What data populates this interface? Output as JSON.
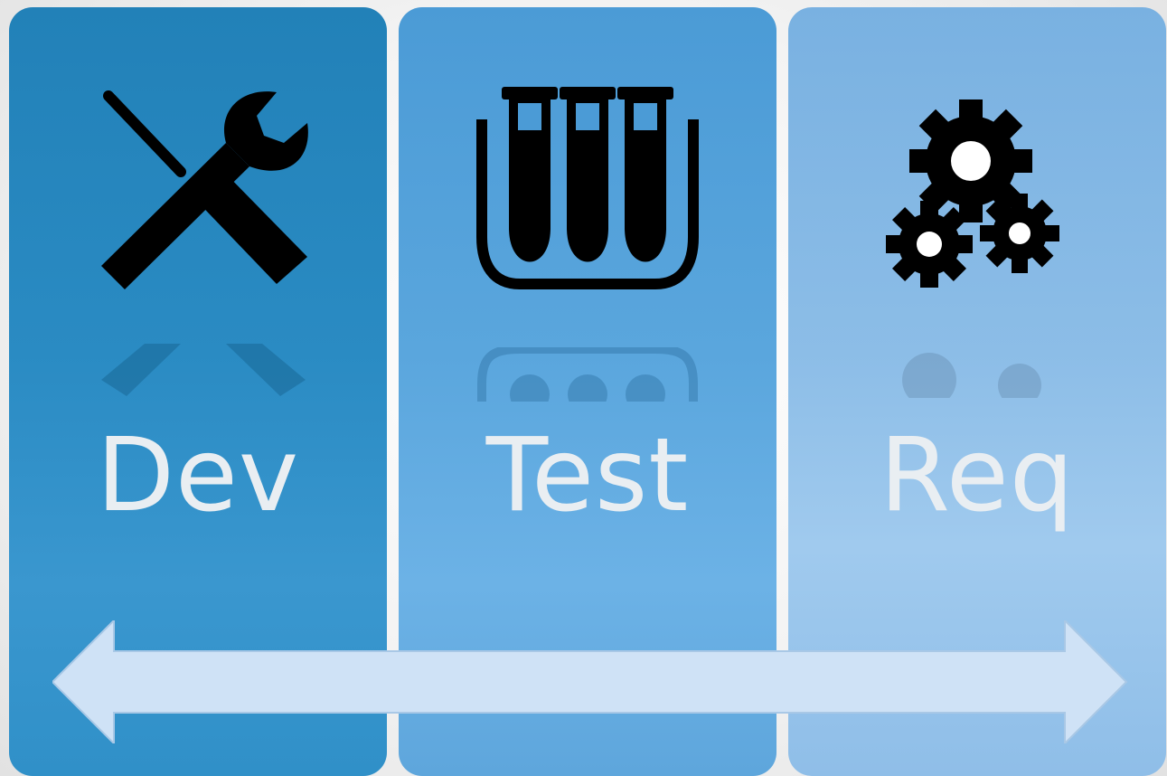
{
  "panels": [
    {
      "label": "Dev",
      "icon": "wrench-screwdriver-icon",
      "color": "#2a8bc3"
    },
    {
      "label": "Test",
      "icon": "test-tubes-icon",
      "color": "#5aa6dd"
    },
    {
      "label": "Req",
      "icon": "gears-icon",
      "color": "#8cbde7"
    }
  ],
  "arrow": {
    "icon": "double-arrow",
    "color": "#cfe2f6"
  }
}
